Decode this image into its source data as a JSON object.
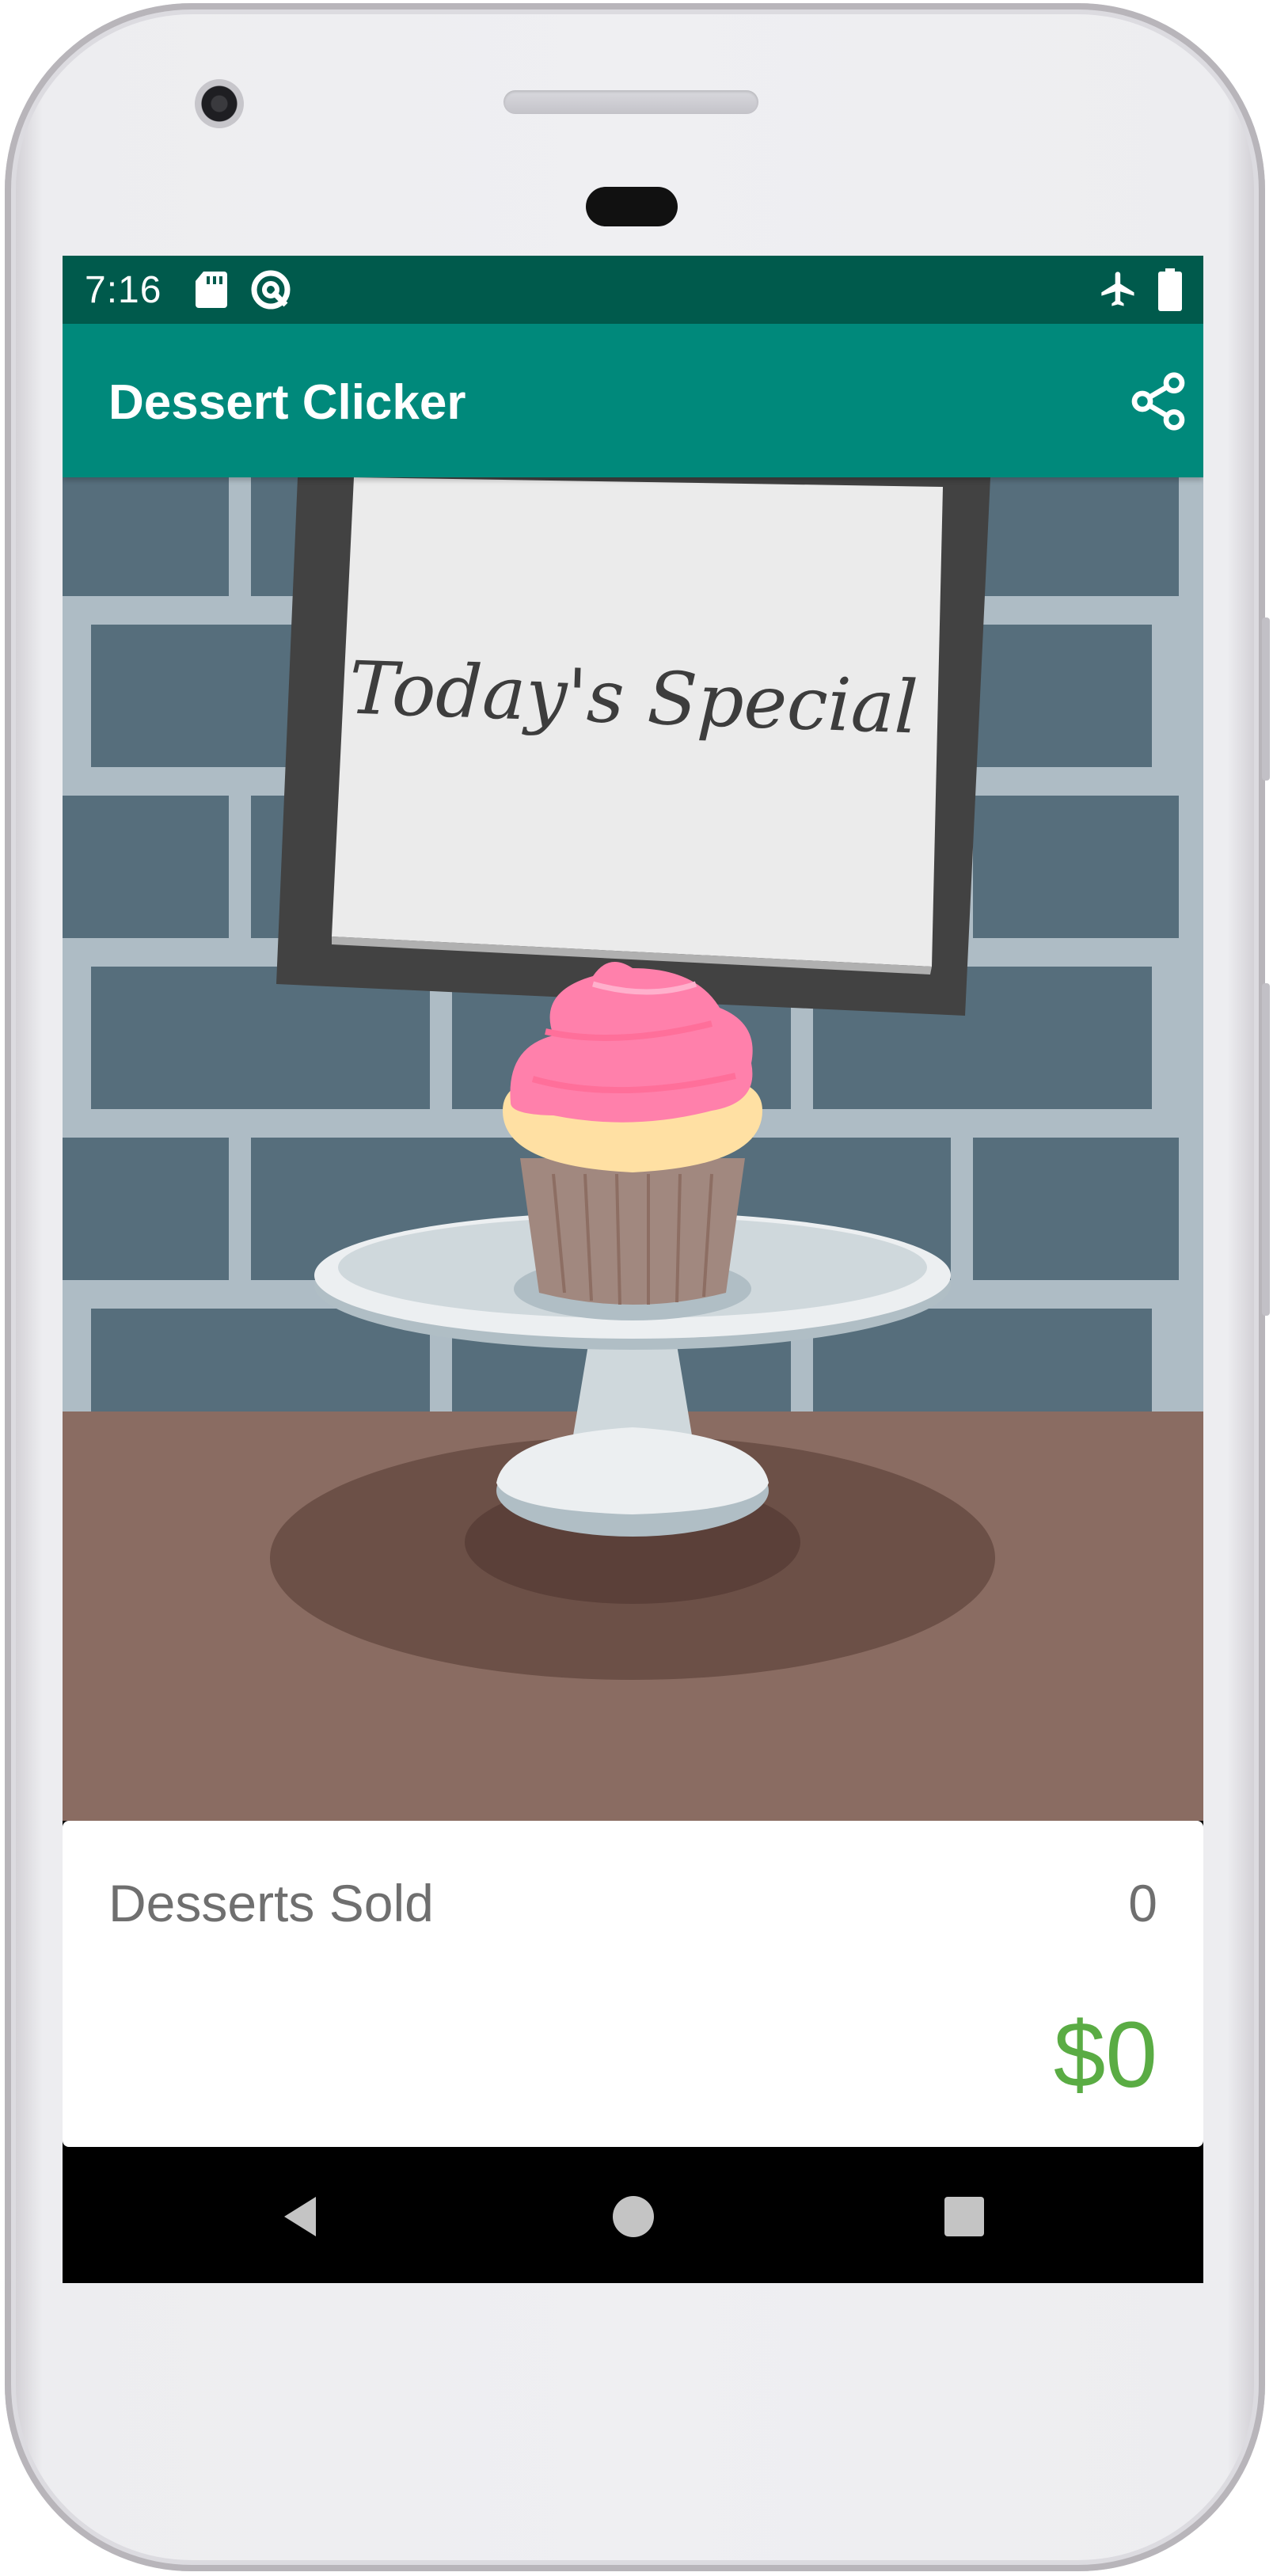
{
  "status_bar": {
    "time": "7:16",
    "left_icons": [
      "sd-card-icon",
      "data-saver-icon"
    ],
    "right_icons": [
      "airplane-mode-icon",
      "battery-icon"
    ],
    "color": "#005a4c"
  },
  "app_bar": {
    "title": "Dessert Clicker",
    "action_icon": "share-icon",
    "color": "#00897b"
  },
  "scene": {
    "sign_text": "Today's Special",
    "dessert": "cupcake"
  },
  "stats": {
    "desserts_sold_label": "Desserts Sold",
    "desserts_sold_count": "0",
    "revenue": "$0",
    "revenue_color": "#5aac44"
  },
  "nav_bar": {
    "icons": [
      "back-icon",
      "home-icon",
      "recents-icon"
    ]
  }
}
